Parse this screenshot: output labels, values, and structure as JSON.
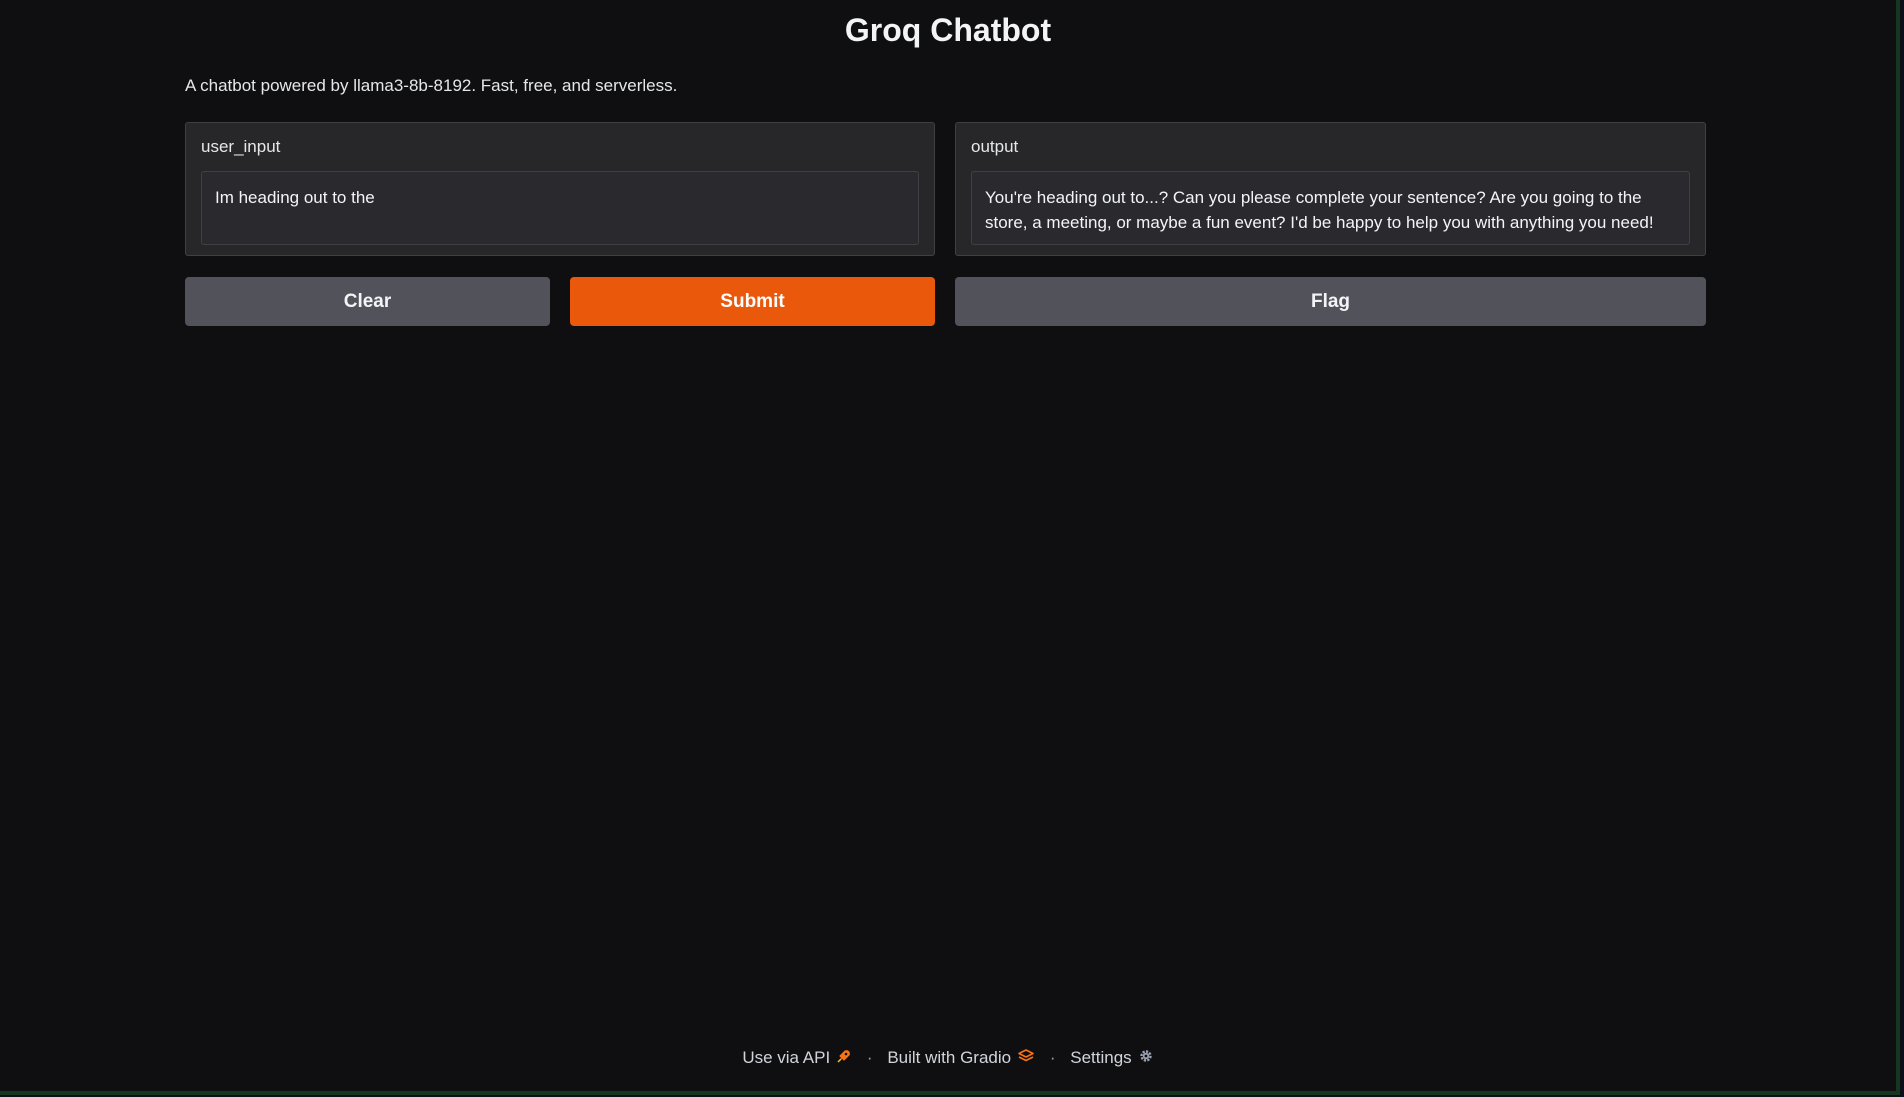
{
  "header": {
    "title": "Groq Chatbot",
    "description": "A chatbot powered by llama3-8b-8192. Fast, free, and serverless."
  },
  "input_panel": {
    "label": "user_input",
    "value": "Im heading out to the"
  },
  "output_panel": {
    "label": "output",
    "value": "You're heading out to...? Can you please complete your sentence? Are you going to the store, a meeting, or maybe a fun event? I'd be happy to help you with anything you need!"
  },
  "buttons": {
    "clear": "Clear",
    "submit": "Submit",
    "flag": "Flag"
  },
  "footer": {
    "api": "Use via API",
    "api_icon": "rocket-icon",
    "separator": "·",
    "built_with": "Built with Gradio",
    "gradio_icon": "gradio-logo-icon",
    "settings": "Settings",
    "settings_icon": "gear-icon"
  },
  "colors": {
    "background": "#0f0f11",
    "panel": "#27272a",
    "primary": "#ea580c",
    "secondary": "#52525b"
  }
}
